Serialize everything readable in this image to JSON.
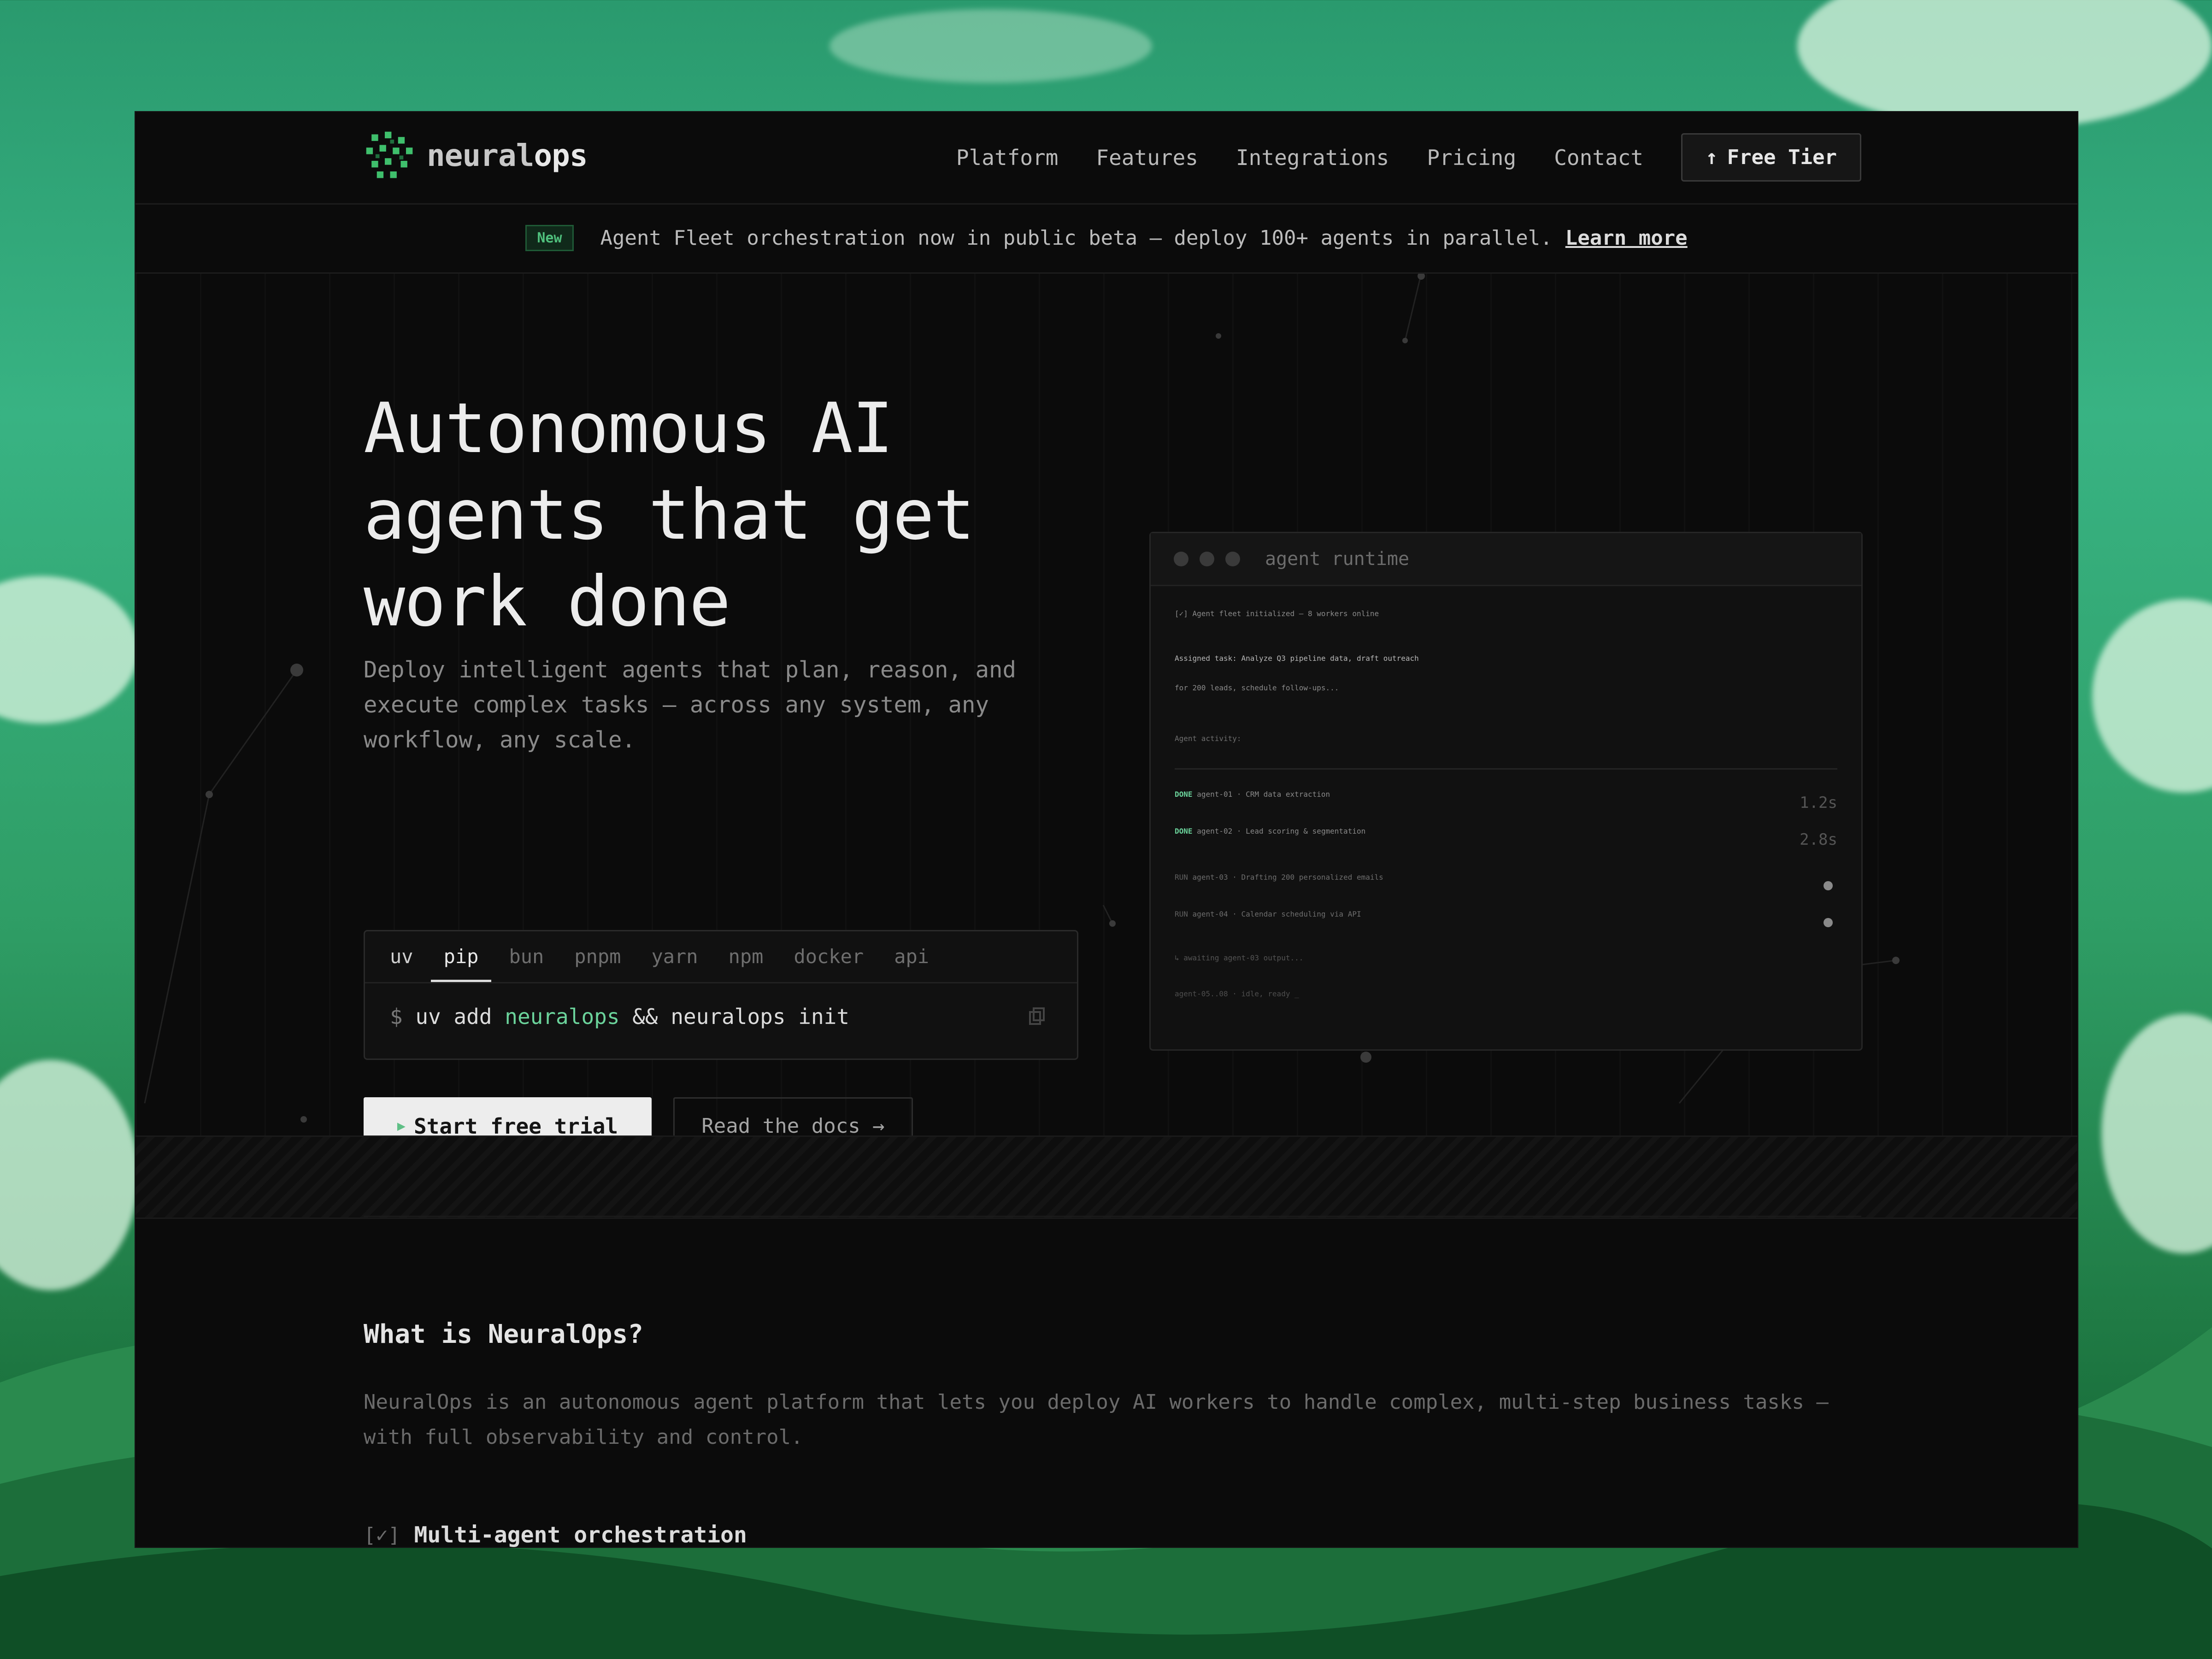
{
  "nav": {
    "logo_part1": "neural",
    "logo_part2": "ops",
    "items": [
      "Platform",
      "Features",
      "Integrations",
      "Pricing",
      "Contact"
    ],
    "cta_label": "Free Tier",
    "cta_icon": "arrow-up-icon"
  },
  "banner": {
    "badge": "New",
    "text": "Agent Fleet orchestration now in public beta — deploy 100+ agents in parallel.",
    "link": "Learn more"
  },
  "hero": {
    "title_line1": "Autonomous AI",
    "title_line2": "agents that get",
    "title_line3": "work done",
    "subtitle": "Deploy intelligent agents that plan, reason, and execute complex tasks — across any system, any workflow, any scale.",
    "install_tabs": [
      "uv",
      "pip",
      "bun",
      "pnpm",
      "yarn",
      "npm",
      "docker",
      "api"
    ],
    "active_tab": "pip",
    "cmd_prompt": "$",
    "cmd_part1": "uv add",
    "cmd_pkg": "neuralops",
    "cmd_part2": "&& neuralops init",
    "primary_button": "Start free trial",
    "secondary_button": "Read the docs →"
  },
  "terminal": {
    "title": "agent runtime",
    "init_line": "[✓] Agent fleet initialized — 8 workers online",
    "task_line1": "Assigned task: Analyze Q3 pipeline data, draft outreach",
    "task_line2": "for 200 leads, schedule follow-ups...",
    "activity_label": "Agent activity:",
    "rows": [
      {
        "status": "DONE",
        "text": "agent-01 · CRM data extraction",
        "time": "1.2s"
      },
      {
        "status": "DONE",
        "text": "agent-02 · Lead scoring & segmentation",
        "time": "2.8s"
      },
      {
        "status": "RUN",
        "text": "agent-03 · Drafting 200 personalized emails",
        "time": ""
      },
      {
        "status": "RUN",
        "text": "agent-04 · Calendar scheduling via API",
        "time": ""
      }
    ],
    "await_line": "↳ awaiting agent-03 output...",
    "idle_line": "agent-05..08 · idle, ready _"
  },
  "about": {
    "title": "What is NeuralOps?",
    "text": "NeuralOps is an autonomous agent platform that lets you deploy AI workers to handle complex, multi-step business tasks — with full observability and control.",
    "feature_check": "[✓]",
    "feature_label": "Multi-agent orchestration"
  },
  "colors": {
    "accent_green": "#6bd39b",
    "background": "#0b0b0b"
  }
}
